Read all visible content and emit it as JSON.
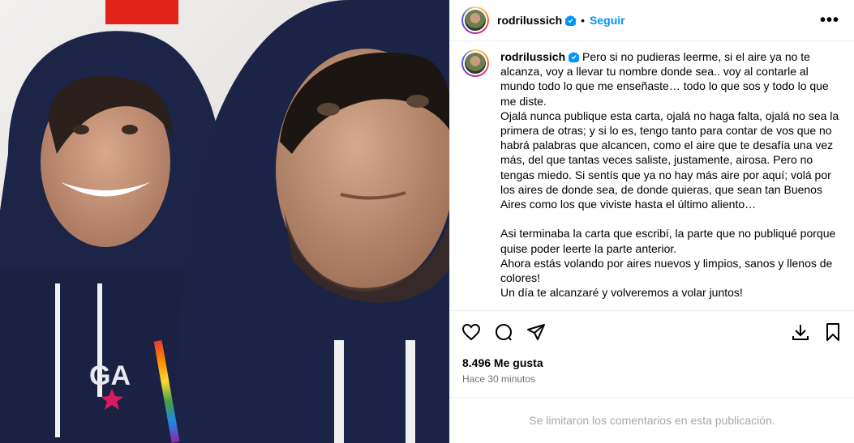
{
  "post": {
    "username": "rodrilussich",
    "follow_label": "Seguir",
    "separator": "•",
    "more_label": "•••",
    "caption": "Pero si no pudieras leerme, si el aire ya no te alcanza, voy a llevar tu nombre donde sea.. voy al contarle al mundo todo lo que me enseñaste… todo lo que sos y todo lo que me diste.\nOjalá nunca publique esta carta, ojalá no haga falta, ojalá no sea la primera de otras; y si lo es, tengo tanto para contar de vos que no habrá palabras que alcancen, como el aire que te desafía una vez más, del que tantas veces saliste, justamente, airosa. Pero no tengas miedo. Si sentís que ya no hay más aire por aquí; volá por los aires de donde sea, de donde quieras, que sean tan Buenos Aires como los que viviste hasta el último aliento…\n\nAsi terminaba la carta que escribí, la parte que no publiqué porque quise poder leerte la parte anterior.\nAhora estás volando por aires nuevos y limpios, sanos y llenos de colores!\nUn día te alcanzaré y volveremos a volar juntos!",
    "likes": "8.496 Me gusta",
    "time": "Hace 30 minutos",
    "comments_disabled": "Se limitaron los comentarios en esta publicación.",
    "photo_text": "GA",
    "icons": [
      "heart-icon",
      "comment-icon",
      "share-icon",
      "download-icon",
      "bookmark-icon",
      "verified-icon",
      "more-icon"
    ]
  },
  "colors": {
    "link": "#0095f6",
    "muted": "#737373",
    "hoodie": "#1c2448"
  }
}
